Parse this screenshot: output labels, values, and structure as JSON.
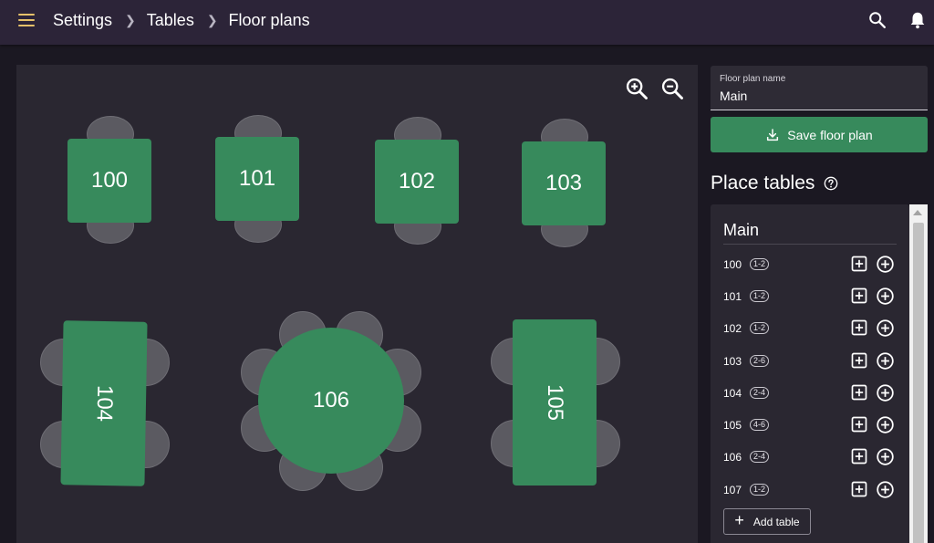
{
  "breadcrumbs": [
    "Settings",
    "Tables",
    "Floor plans"
  ],
  "floor_plan": {
    "name_label": "Floor plan name",
    "name_value": "Main",
    "save_label": "Save floor plan"
  },
  "place_tables": {
    "title": "Place tables",
    "section": "Main",
    "rows": [
      {
        "number": "100",
        "capacity": "1-2"
      },
      {
        "number": "101",
        "capacity": "1-2"
      },
      {
        "number": "102",
        "capacity": "1-2"
      },
      {
        "number": "103",
        "capacity": "2-6"
      },
      {
        "number": "104",
        "capacity": "2-4"
      },
      {
        "number": "105",
        "capacity": "4-6"
      },
      {
        "number": "106",
        "capacity": "2-4"
      },
      {
        "number": "107",
        "capacity": "1-2"
      }
    ],
    "add_table_label": "Add table"
  },
  "canvas_tables": [
    "100",
    "101",
    "102",
    "103",
    "104",
    "105",
    "106"
  ],
  "colors": {
    "accent_green": "#378a5c",
    "menu_icon": "#e6c16a",
    "topbar": "#2c2438",
    "canvas": "#2a2731"
  },
  "icons": {
    "menu": "menu-icon",
    "search": "search-icon",
    "notifications": "bell-icon",
    "zoom_in": "zoom-in-icon",
    "zoom_out": "zoom-out-icon",
    "save": "download-icon",
    "help": "help-circle-icon",
    "add_square": "add-box-icon",
    "add_circle": "add-circle-icon"
  }
}
